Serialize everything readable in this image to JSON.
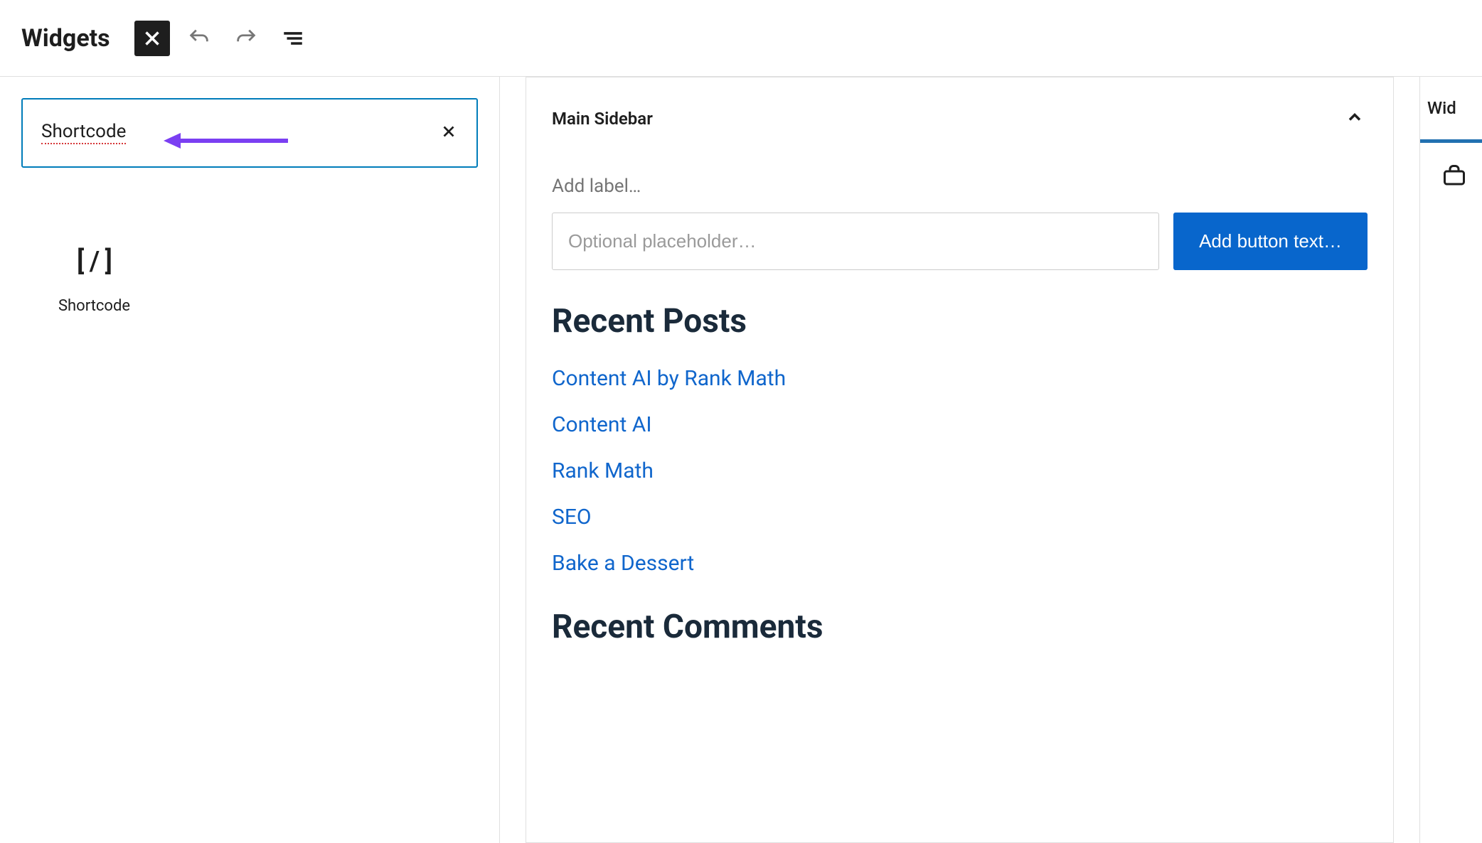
{
  "header": {
    "title": "Widgets"
  },
  "search": {
    "value": "Shortcode"
  },
  "result": {
    "icon_text": "[ / ]",
    "label": "Shortcode"
  },
  "widget_area": {
    "area_title": "Main Sidebar",
    "add_label_placeholder": "Add label…",
    "optional_placeholder": "Optional placeholder…",
    "button_placeholder": "Add button text…",
    "recent_posts_heading": "Recent Posts",
    "posts": [
      "Content AI by Rank Math",
      "Content AI",
      "Rank Math",
      "SEO",
      "Bake a Dessert"
    ],
    "recent_comments_heading": "Recent Comments"
  },
  "right": {
    "tab_label_partial": "Wid"
  }
}
